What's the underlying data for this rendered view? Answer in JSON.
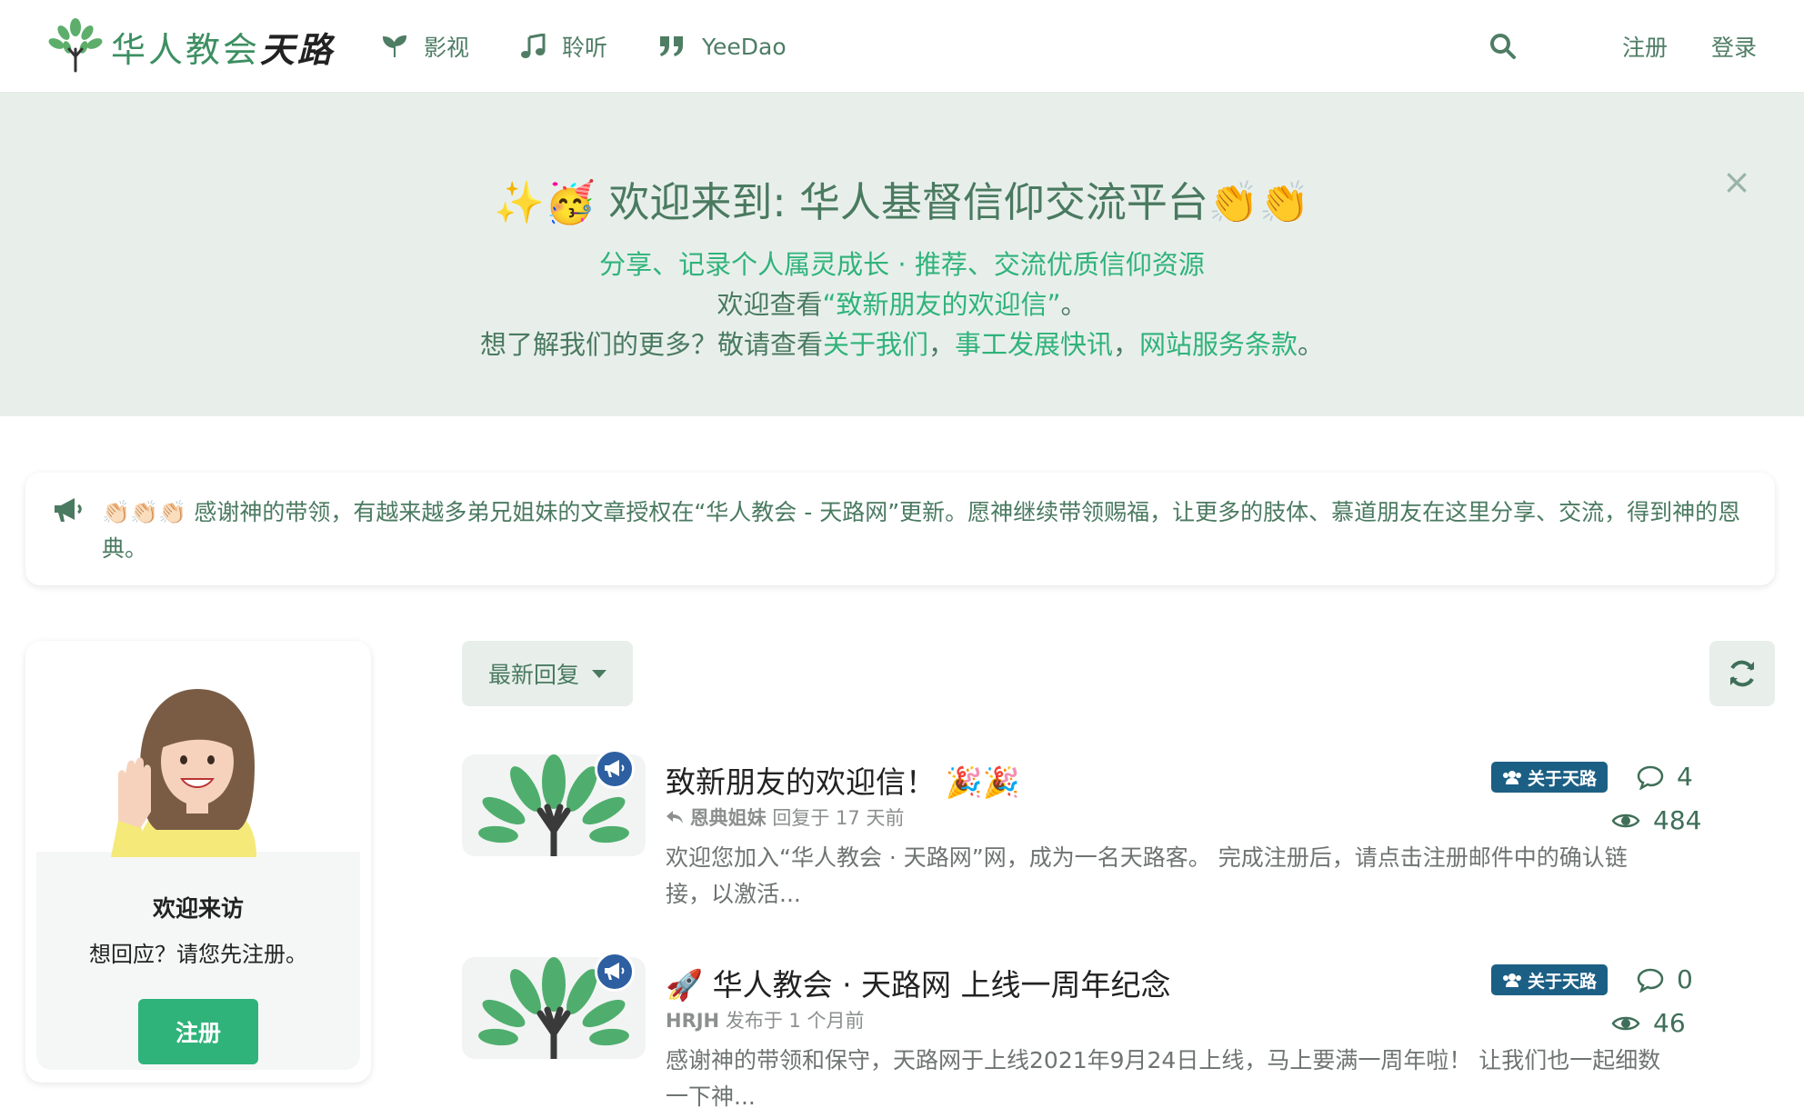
{
  "header": {
    "logo_green": "华人教会",
    "logo_dark": "天路",
    "nav": [
      {
        "label": "影视",
        "icon": "seedling-icon"
      },
      {
        "label": "聆听",
        "icon": "music-note-icon"
      },
      {
        "label": "YeeDao",
        "icon": "quote-icon"
      }
    ],
    "register": "注册",
    "login": "登录"
  },
  "banner": {
    "title": "✨🥳 欢迎来到: 华人基督信仰交流平台👏👏",
    "line1": "分享、记录个人属灵成长 · 推荐、交流优质信仰资源",
    "line2_prefix": "欢迎查看",
    "line2_link": "“致新朋友的欢迎信”",
    "line2_suffix": "。",
    "line3_prefix": "想了解我们的更多？敬请查看",
    "line3_link1": "关于我们",
    "line3_sep1": "，",
    "line3_link2": "事工发展快讯",
    "line3_sep2": "，",
    "line3_link3": "网站服务条款",
    "line3_suffix": "。",
    "close": "×"
  },
  "announcement": {
    "text": "👏🏻👏🏻👏🏻 感谢神的带领，有越来越多弟兄姐妹的文章授权在“华人教会 - 天路网”更新。愿神继续带领赐福，让更多的肢体、慕道朋友在这里分享、交流，得到神的恩典。"
  },
  "welcome": {
    "title": "欢迎来访",
    "subtitle": "想回应？请您先注册。",
    "button": "注册"
  },
  "list": {
    "sort_label": "最新回复"
  },
  "topics": [
    {
      "title": "致新朋友的欢迎信！ 🎉🎉",
      "author": "恩典姐妹",
      "action": "回复于 17 天前",
      "excerpt": "欢迎您加入“华人教会 · 天路网”网，成为一名天路客。 完成注册后，请点击注册邮件中的确认链接，以激活...",
      "category": "关于天路",
      "replies": "4",
      "views": "484"
    },
    {
      "title": "🚀 华人教会 · 天路网 上线一周年纪念",
      "author": "HRJH",
      "action": "发布于 1 个月前",
      "excerpt": "感谢神的带领和保守，天路网于上线2021年9月24日上线，马上要满一周年啦！ 让我们也一起细数一下神...",
      "category": "关于天路",
      "replies": "0",
      "views": "46"
    }
  ],
  "colors": {
    "brand_green": "#2fb37a",
    "text_green": "#4a7a60",
    "banner_bg": "#e8efeb",
    "category_blue": "#1c5f84",
    "pin_blue": "#2d5fa1"
  }
}
